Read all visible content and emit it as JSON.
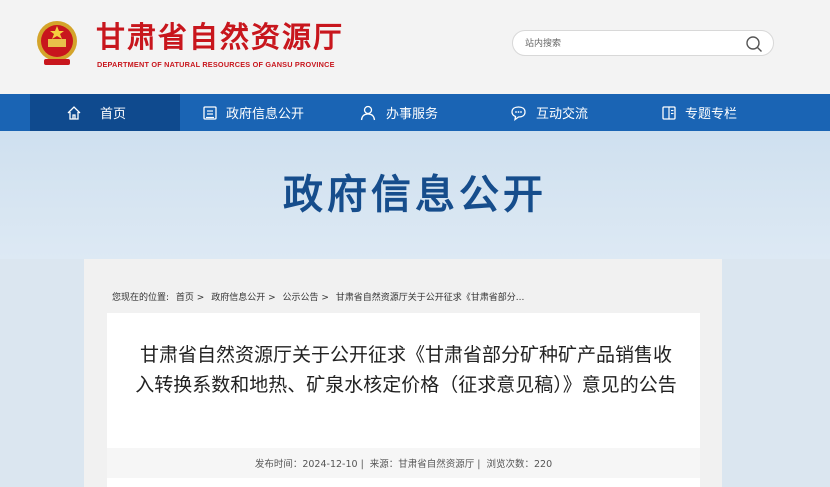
{
  "header": {
    "title": "甘肃省自然资源厅",
    "subtitle": "DEPARTMENT OF NATURAL RESOURCES OF GANSU PROVINCE",
    "search_placeholder": "站内搜索",
    "brand_color": "#c8161d"
  },
  "nav": {
    "items": [
      {
        "label": "首页",
        "icon": "home-icon"
      },
      {
        "label": "政府信息公开",
        "icon": "document-icon"
      },
      {
        "label": "办事服务",
        "icon": "person-icon"
      },
      {
        "label": "互动交流",
        "icon": "chat-icon"
      },
      {
        "label": "专题专栏",
        "icon": "book-icon"
      }
    ],
    "color": "#1a64b4"
  },
  "banner": {
    "title": "政府信息公开"
  },
  "breadcrumb": {
    "prefix": "您现在的位置:",
    "items": [
      "首页 >",
      "政府信息公开 >",
      "公示公告 >",
      "甘肃省自然资源厅关于公开征求《甘肃省部分..."
    ]
  },
  "article": {
    "title": "甘肃省自然资源厅关于公开征求《甘肃省部分矿种矿产品销售收入转换系数和地热、矿泉水核定价格（征求意见稿）》意见的公告",
    "date": "发布时间：2024-12-10 |",
    "source": "来源：甘肃省自然资源厅 |",
    "views": "浏览次数：220"
  }
}
